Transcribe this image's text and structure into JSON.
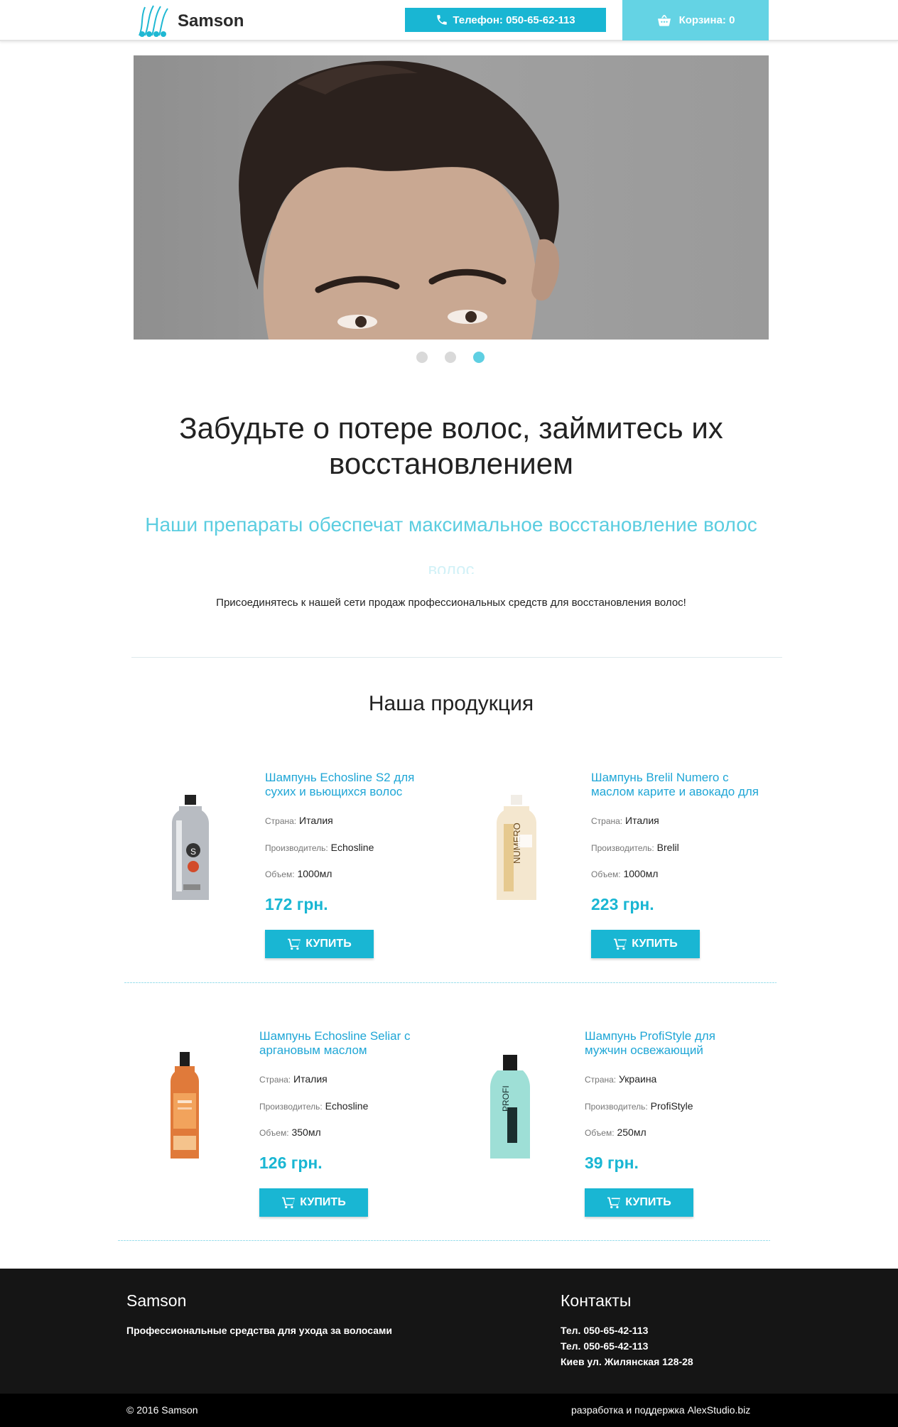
{
  "header": {
    "logo_text": "Samson",
    "phone_label": "Телефон: 050-65-62-113",
    "cart_label": "Корзина: 0"
  },
  "hero": {
    "slides_count": 3,
    "active_slide": 3
  },
  "intro": {
    "headline": "Забудьте о потере волос, займитесь их восстановлением",
    "subheadline": "Наши препараты обеспечат максимальное восстановление волос",
    "subheadline_overflow": "волос",
    "join_text": "Присоединятесь к нашей сети продаж профессиональных средств для восстановления волос!"
  },
  "products_section": {
    "title": "Наша продукция",
    "labels": {
      "country": "Страна:",
      "maker": "Производитель:",
      "volume": "Объем:"
    },
    "buy_label": "КУПИТЬ",
    "items": [
      {
        "name": "Шампунь Echosline S2 для сухих и вьющихся волос",
        "country": "Италия",
        "maker": "Echosline",
        "volume": "1000мл",
        "price": "172 грн.",
        "bottle": "silver-bottle"
      },
      {
        "name": "Шампунь Brelil Numero с маслом карите и авокадо для сухих волос",
        "country": "Италия",
        "maker": "Brelil",
        "volume": "1000мл",
        "price": "223 грн.",
        "bottle": "cream-bottle"
      },
      {
        "name": "Шампунь Echosline Seliar с аргановым маслом",
        "country": "Италия",
        "maker": "Echosline",
        "volume": "350мл",
        "price": "126 грн.",
        "bottle": "orange-bottle"
      },
      {
        "name": "Шампунь ProfiStyle для мужчин освежающий",
        "country": "Украина",
        "maker": "ProfiStyle",
        "volume": "250мл",
        "price": "39 грн.",
        "bottle": "teal-bottle"
      }
    ]
  },
  "footer": {
    "brand": "Samson",
    "tagline": "Профессиональные средства для ухода за волосами",
    "contacts_title": "Контакты",
    "phone1": "Тел. 050-65-42-113",
    "phone2": "Тел. 050-65-42-113",
    "address": "Киев ул. Жилянская 128-28",
    "copyright": "© 2016 Samson",
    "credits": "разработка и поддержка AlexStudio.biz"
  },
  "colors": {
    "accent": "#19b6d3",
    "accent_light": "#64d3e4",
    "link": "#1fa6d6",
    "footer_bg": "#151515"
  }
}
